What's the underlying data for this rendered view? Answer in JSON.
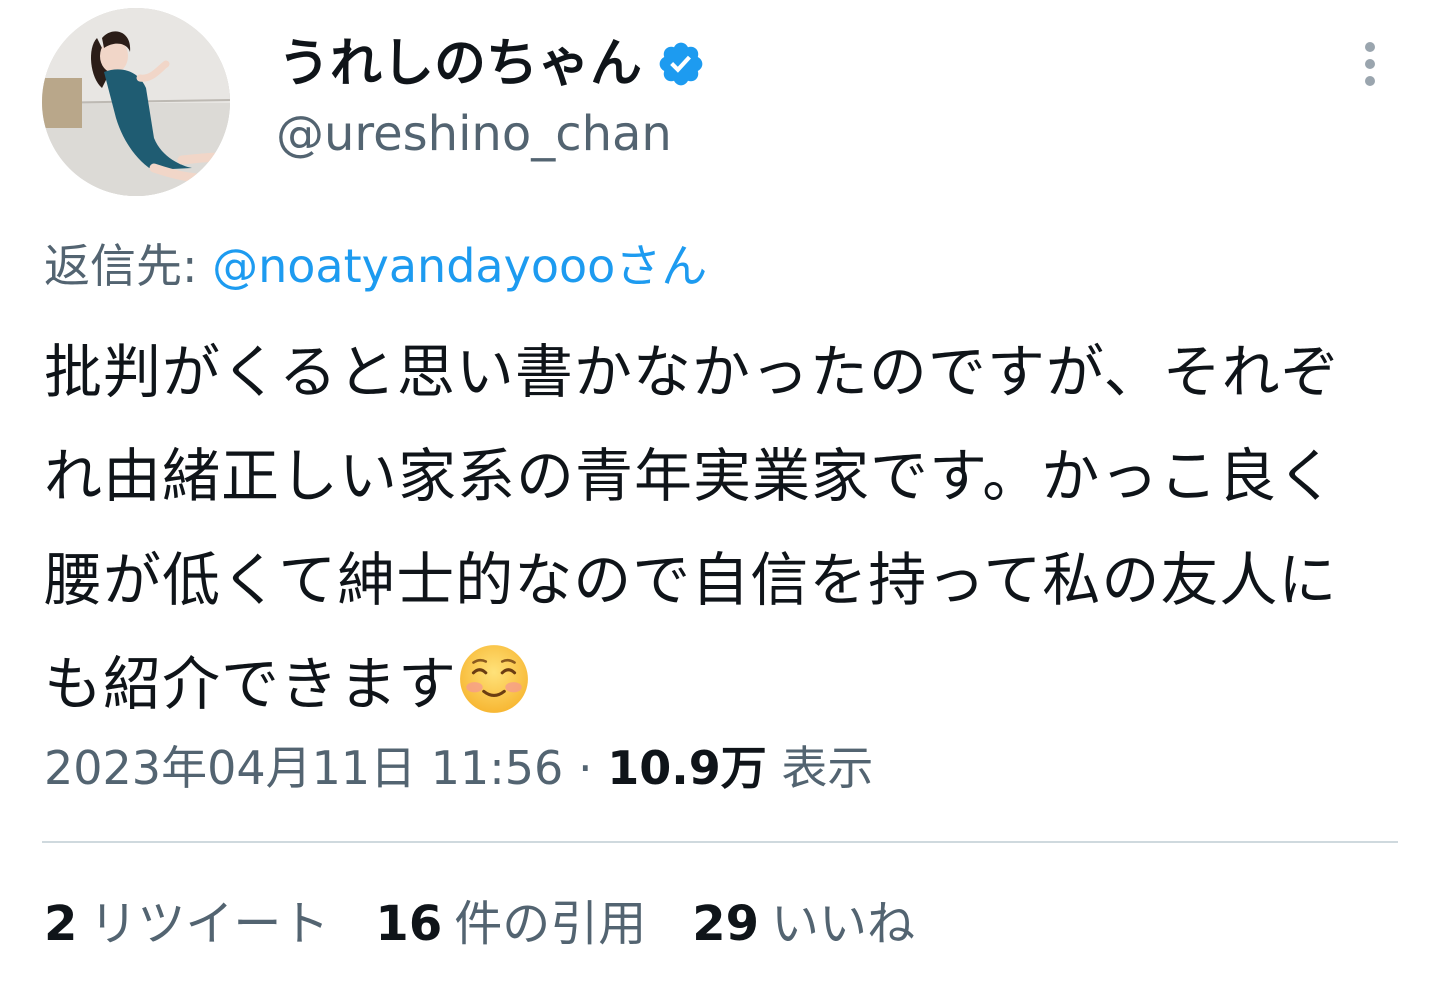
{
  "user": {
    "display_name": "うれしのちゃん",
    "handle": "@ureshino_chan",
    "verified_icon": "verified-badge-icon",
    "avatar_icon": "profile-avatar"
  },
  "reply": {
    "prefix": "返信先: ",
    "mention": "@noatyandayooo",
    "suffix": "さん"
  },
  "tweet": {
    "text": "批判がくると思い書かなかったのですが、それぞれ由緒正しい家系の青年実業家です。かっこ良く腰が低くて紳士的なので自信を持って私の友人にも紹介できます",
    "emoji": "smiling-face-icon"
  },
  "meta": {
    "timestamp": "2023年04月11日 11:56",
    "separator": " · ",
    "views_count": "10.9万",
    "views_label": " 表示"
  },
  "stats": {
    "retweets_count": "2",
    "retweets_label": "リツイート",
    "quotes_count": "16",
    "quotes_label": "件の引用",
    "likes_count": "29",
    "likes_label": "いいね"
  },
  "colors": {
    "text_primary": "#0f1419",
    "text_secondary": "#536471",
    "accent": "#1d9bf0",
    "divider": "#cfd9de"
  }
}
